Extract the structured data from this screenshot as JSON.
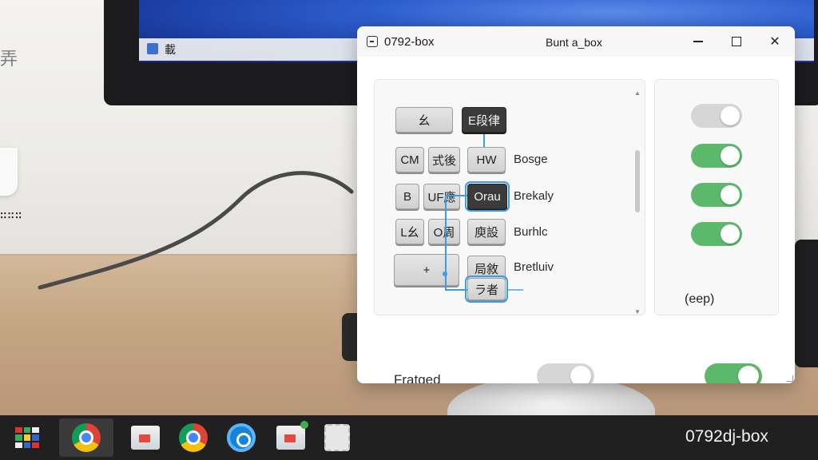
{
  "background": {
    "monitor_taskbar_text": "載",
    "left_glyph": "弄",
    "left_dots": "∷∷∷"
  },
  "window": {
    "title_left": "0792-box",
    "title_center": "Bunt a_box",
    "controls": {
      "minimize": "—",
      "maximize": "□",
      "close": "✕"
    }
  },
  "keyboard": {
    "rows": [
      {
        "keys": [
          {
            "label": "幺",
            "style": "light"
          },
          {
            "label": "E段律",
            "style": "dark"
          }
        ],
        "label": ""
      },
      {
        "keys": [
          {
            "label": "CM",
            "style": "light"
          },
          {
            "label": "式後",
            "style": "light"
          },
          {
            "label": "HW",
            "style": "light"
          }
        ],
        "label": "Bosge"
      },
      {
        "keys": [
          {
            "label": "B",
            "style": "light"
          },
          {
            "label": "UF應",
            "style": "light"
          },
          {
            "label": "Orau",
            "style": "dark"
          }
        ],
        "label": "Brekaly"
      },
      {
        "keys": [
          {
            "label": "L幺",
            "style": "light"
          },
          {
            "label": "O周",
            "style": "light"
          },
          {
            "label": "庾設",
            "style": "light"
          }
        ],
        "label": "Burhlc"
      },
      {
        "keys": [
          {
            "label": "+",
            "style": "light"
          },
          {
            "label": "局敘",
            "style": "light"
          }
        ],
        "label": "Bretluiv"
      },
      {
        "keys": [
          {
            "label": "ラ者",
            "style": "light"
          }
        ],
        "label": ""
      }
    ]
  },
  "toggles": [
    {
      "state": "off"
    },
    {
      "state": "on"
    },
    {
      "state": "on"
    },
    {
      "state": "on"
    }
  ],
  "right_panel_text": "(eep)",
  "footer": {
    "label": "Fratged",
    "toggle_1": "off",
    "toggle_2": "on"
  },
  "taskbar": {
    "items": [
      "start-icon",
      "chrome-icon",
      "file-explorer-icon",
      "chrome-icon",
      "update-icon",
      "file-explorer-icon",
      "app-icon"
    ],
    "right_text": "0792dj-box"
  },
  "colors": {
    "toggle_on": "#5cb86b",
    "toggle_off": "#d6d6d6",
    "accent": "#3e9be8",
    "taskbar": "#202020"
  }
}
